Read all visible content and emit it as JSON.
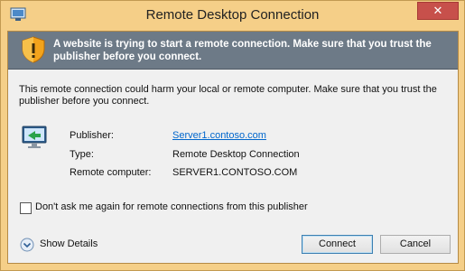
{
  "window": {
    "title": "Remote Desktop Connection",
    "close_glyph": "✕"
  },
  "banner": {
    "text": "A website is trying to start a remote connection. Make sure that you trust the publisher before you connect.",
    "icon": "warning-shield-icon"
  },
  "description": "This remote connection could harm your local or remote computer. Make sure that you trust the publisher before you connect.",
  "details_icon": "remote-computer-icon",
  "fields": {
    "publisher_label": "Publisher:",
    "publisher_value": "Server1.contoso.com",
    "type_label": "Type:",
    "type_value": "Remote Desktop Connection",
    "remote_label": "Remote computer:",
    "remote_value": "SERVER1.CONTOSO.COM"
  },
  "dont_ask": {
    "label": "Don't ask me again for remote connections from this publisher",
    "checked": false
  },
  "show_details": {
    "label": "Show Details",
    "icon": "chevron-down-circle-icon"
  },
  "buttons": {
    "connect": "Connect",
    "cancel": "Cancel"
  },
  "colors": {
    "frame": "#f5cf88",
    "banner": "#6d7a87",
    "close": "#c7504b",
    "link": "#0066cc"
  }
}
